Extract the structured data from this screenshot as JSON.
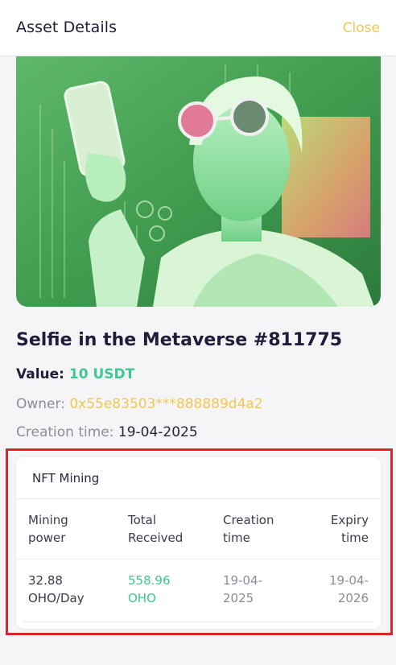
{
  "header": {
    "title": "Asset Details",
    "close_label": "Close"
  },
  "asset": {
    "name": "Selfie in the Metaverse #811775",
    "value_label": "Value:",
    "value": "10 USDT",
    "owner_label": "Owner:",
    "owner": "0x55e83503***888889d4a2",
    "creation_label": "Creation time:",
    "creation_time": "19-04-2025"
  },
  "mining": {
    "title": "NFT Mining",
    "headers": {
      "mining_power": "Mining power",
      "total_received": "Total Received",
      "creation_time": "Creation time",
      "expiry_time": "Expiry time"
    },
    "row": {
      "mining_power": "32.88 OHO/Day",
      "total_received": "558.96 OHO",
      "creation_time": "19-04-2025",
      "expiry_time": "19-04-2026"
    }
  },
  "colors": {
    "accent_yellow": "#f2c84b",
    "accent_green": "#3cc98f",
    "highlight_red": "#e0262d"
  }
}
